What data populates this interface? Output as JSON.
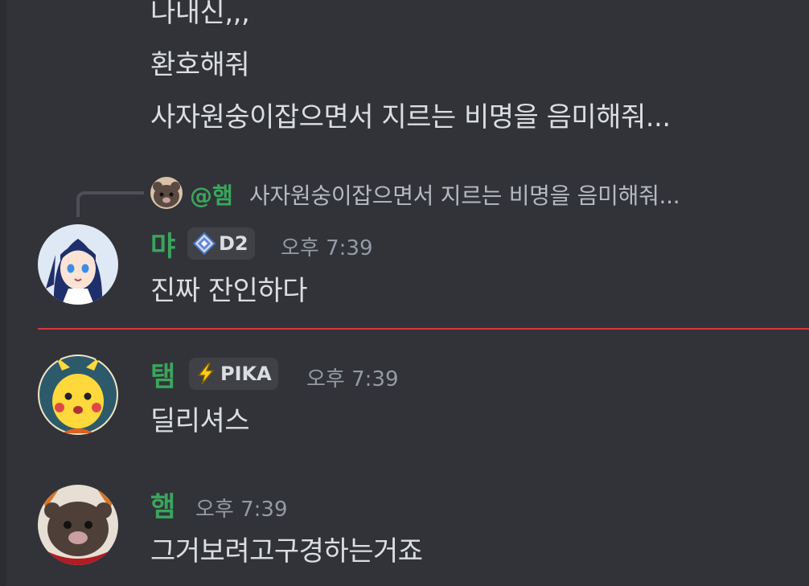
{
  "earlier_lines": [
    "나내신,,,",
    "환호해줘",
    "사자원숭이잡으면서 지르는 비명을 음미해줘..."
  ],
  "reply": {
    "mention": "@햄",
    "text": "사자원숭이잡으면서 지르는 비명을 음미해줘..."
  },
  "messages": [
    {
      "username": "먀",
      "username_color": "#3ba55d",
      "tag": "D2",
      "tag_icon": "diamond-icon",
      "timestamp": "오후 7:39",
      "text": "진짜 잔인하다"
    },
    {
      "username": "탬",
      "username_color": "#3ba55d",
      "tag": "PIKA",
      "tag_icon": "lightning-icon",
      "timestamp": "오후 7:39",
      "text": "딜리셔스"
    },
    {
      "username": "햄",
      "username_color": "#3ba55d",
      "timestamp": "오후 7:39",
      "text": "그거보려고구경하는거죠"
    }
  ],
  "colors": {
    "background": "#313338",
    "text": "#dbdee1",
    "muted": "#949ba4",
    "username": "#3ba55d",
    "new_divider": "#da373c",
    "tag_bg": "#3f4147"
  }
}
